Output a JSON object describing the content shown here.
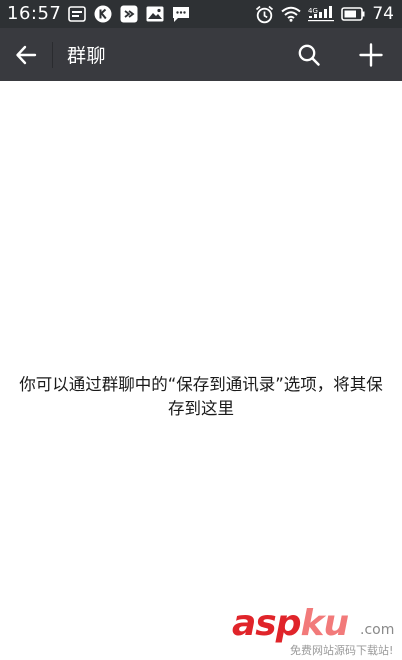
{
  "status_bar": {
    "time": "16:57",
    "notifications": [
      "ad-card-icon",
      "k-app-icon",
      "sync-app-icon",
      "image-icon",
      "chat-bubble-icon"
    ],
    "signal_label": "4G",
    "battery_level": "74"
  },
  "action_bar": {
    "title": "群聊",
    "icons": [
      "back-arrow-icon",
      "search-icon",
      "plus-icon"
    ]
  },
  "empty_state": {
    "message": "你可以通过群聊中的“保存到通讯录”选项，将其保存到这里"
  },
  "watermark": {
    "brand_asp": "asp",
    "brand_ku": "ku",
    "brand_dotcom": ".com",
    "tagline": "免费网站源码下载站!"
  },
  "colors": {
    "status_bar_bg": "#2e3134",
    "action_bar_bg": "#393a3f",
    "page_bg": "#ffffff",
    "watermark_red": "#e0242a"
  }
}
